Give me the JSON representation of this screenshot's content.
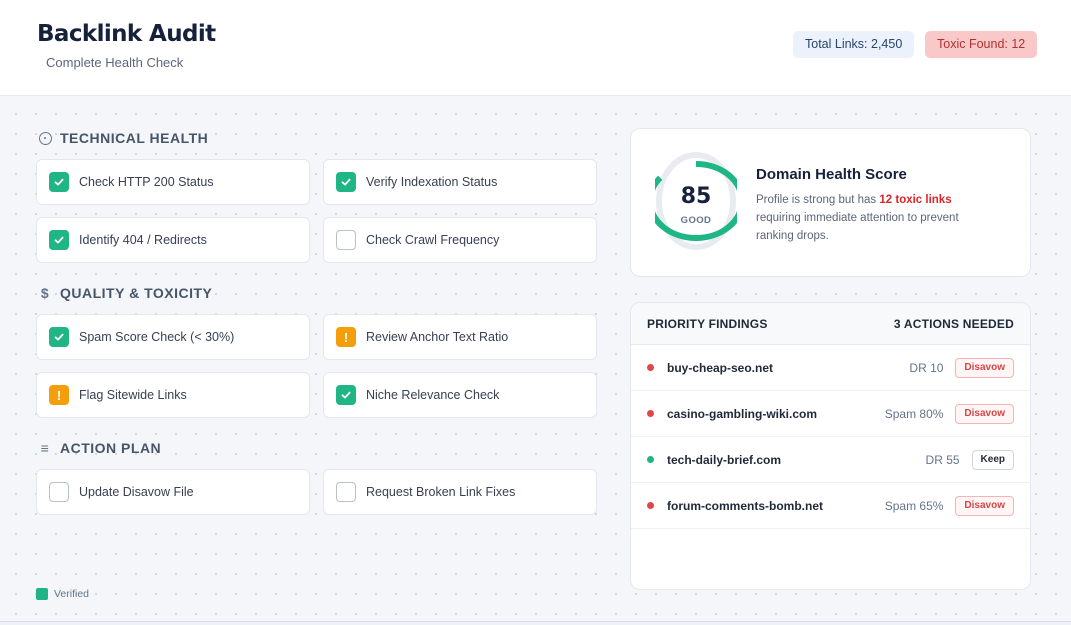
{
  "header": {
    "title": "Backlink Audit",
    "subtitle": "Complete Health Check",
    "total_links": "Total Links: 2,450",
    "toxic_found": "Toxic Found: 12"
  },
  "sections": [
    {
      "title": "TECHNICAL HEALTH",
      "icon": "info-circle-icon",
      "items": [
        {
          "label": "Check HTTP 200 Status",
          "state": "checked"
        },
        {
          "label": "Verify Indexation Status",
          "state": "checked"
        },
        {
          "label": "Identify 404 / Redirects",
          "state": "checked"
        },
        {
          "label": "Check Crawl Frequency",
          "state": "unchecked"
        }
      ]
    },
    {
      "title": "QUALITY & TOXICITY",
      "icon": "dollar-icon",
      "items": [
        {
          "label": "Spam Score Check (< 30%)",
          "state": "checked"
        },
        {
          "label": "Review Anchor Text Ratio",
          "state": "warning"
        },
        {
          "label": "Flag Sitewide Links",
          "state": "warning"
        },
        {
          "label": "Niche Relevance Check",
          "state": "checked"
        }
      ]
    },
    {
      "title": "ACTION PLAN",
      "icon": "list-icon",
      "items": [
        {
          "label": "Update Disavow File",
          "state": "unchecked"
        },
        {
          "label": "Request Broken Link Fixes",
          "state": "unchecked"
        }
      ]
    }
  ],
  "score": {
    "value": "85",
    "fraction": 0.85,
    "label": "GOOD",
    "title": "Domain Health Score",
    "desc_before": "Profile is strong but has ",
    "desc_highlight": "12 toxic links",
    "desc_after": " requiring immediate attention to prevent ranking drops."
  },
  "findings": {
    "title": "PRIORITY FINDINGS",
    "count_label": "3 ACTIONS NEEDED",
    "rows": [
      {
        "domain": "buy-cheap-seo.net",
        "metric": "DR 10",
        "action": "Disavow",
        "status": "toxic"
      },
      {
        "domain": "casino-gambling-wiki.com",
        "metric": "Spam 80%",
        "action": "Disavow",
        "status": "toxic"
      },
      {
        "domain": "tech-daily-brief.com",
        "metric": "DR 55",
        "action": "Keep",
        "status": "safe"
      },
      {
        "domain": "forum-comments-bomb.net",
        "metric": "Spam 65%",
        "action": "Disavow",
        "status": "toxic"
      }
    ]
  },
  "legend": {
    "label": "Verified"
  },
  "colors": {
    "accent_green": "#1fb584",
    "warning_orange": "#f59e0b",
    "toxic_red": "#dc2626",
    "title_navy": "#16213a"
  }
}
